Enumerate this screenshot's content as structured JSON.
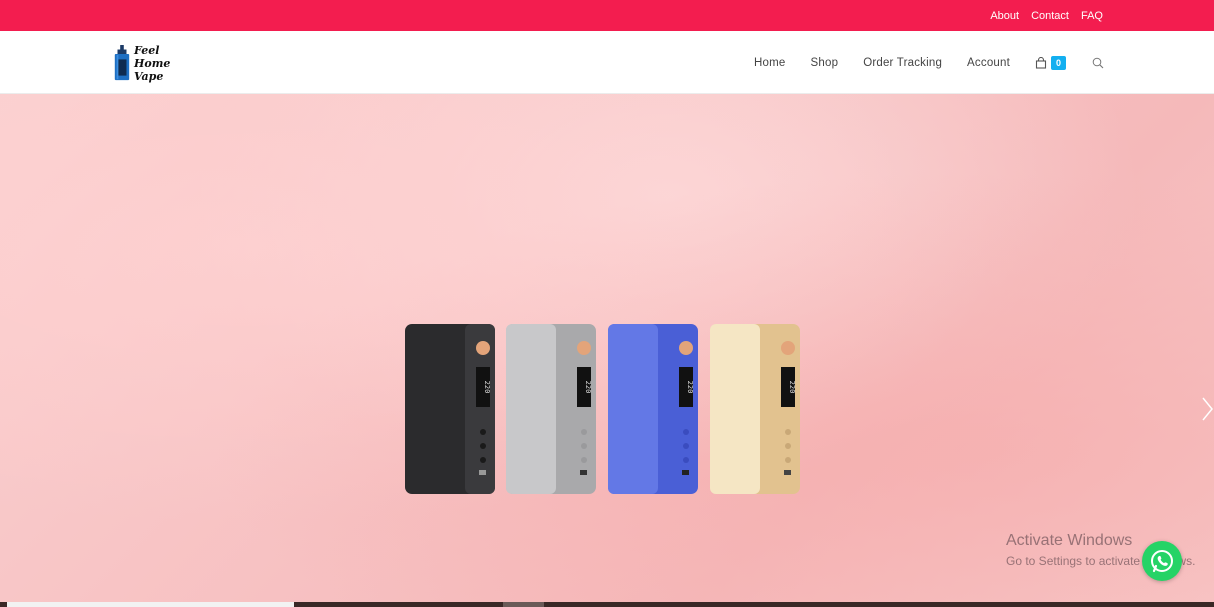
{
  "topbar": {
    "background": "#f31d4f",
    "links": [
      "About",
      "Contact",
      "FAQ"
    ]
  },
  "header": {
    "logo": {
      "line1": "Feel Home",
      "line2": "Vape",
      "icon": "vape-bottle-icon"
    },
    "nav": [
      "Home",
      "Shop",
      "Order Tracking",
      "Account"
    ],
    "cart": {
      "icon": "shopping-bag-icon",
      "count": "0",
      "badge_color": "#13aff0"
    },
    "search_icon": "search-icon"
  },
  "hero": {
    "products": [
      {
        "name": "black-mod",
        "body": "#2b2b2d",
        "screen": "220"
      },
      {
        "name": "silver-mod",
        "body": "#bdbdbf",
        "screen": "220"
      },
      {
        "name": "blue-mod",
        "body": "#5a6fe0",
        "screen": "220"
      },
      {
        "name": "gold-mod",
        "body": "#f0dcb0",
        "screen": "220"
      }
    ],
    "next_icon": "chevron-right-icon"
  },
  "watermark": {
    "title": "Activate Windows",
    "subtitle": "Go to Settings to activate Windows."
  },
  "whatsapp": {
    "icon": "whatsapp-icon",
    "color": "#25d366"
  }
}
